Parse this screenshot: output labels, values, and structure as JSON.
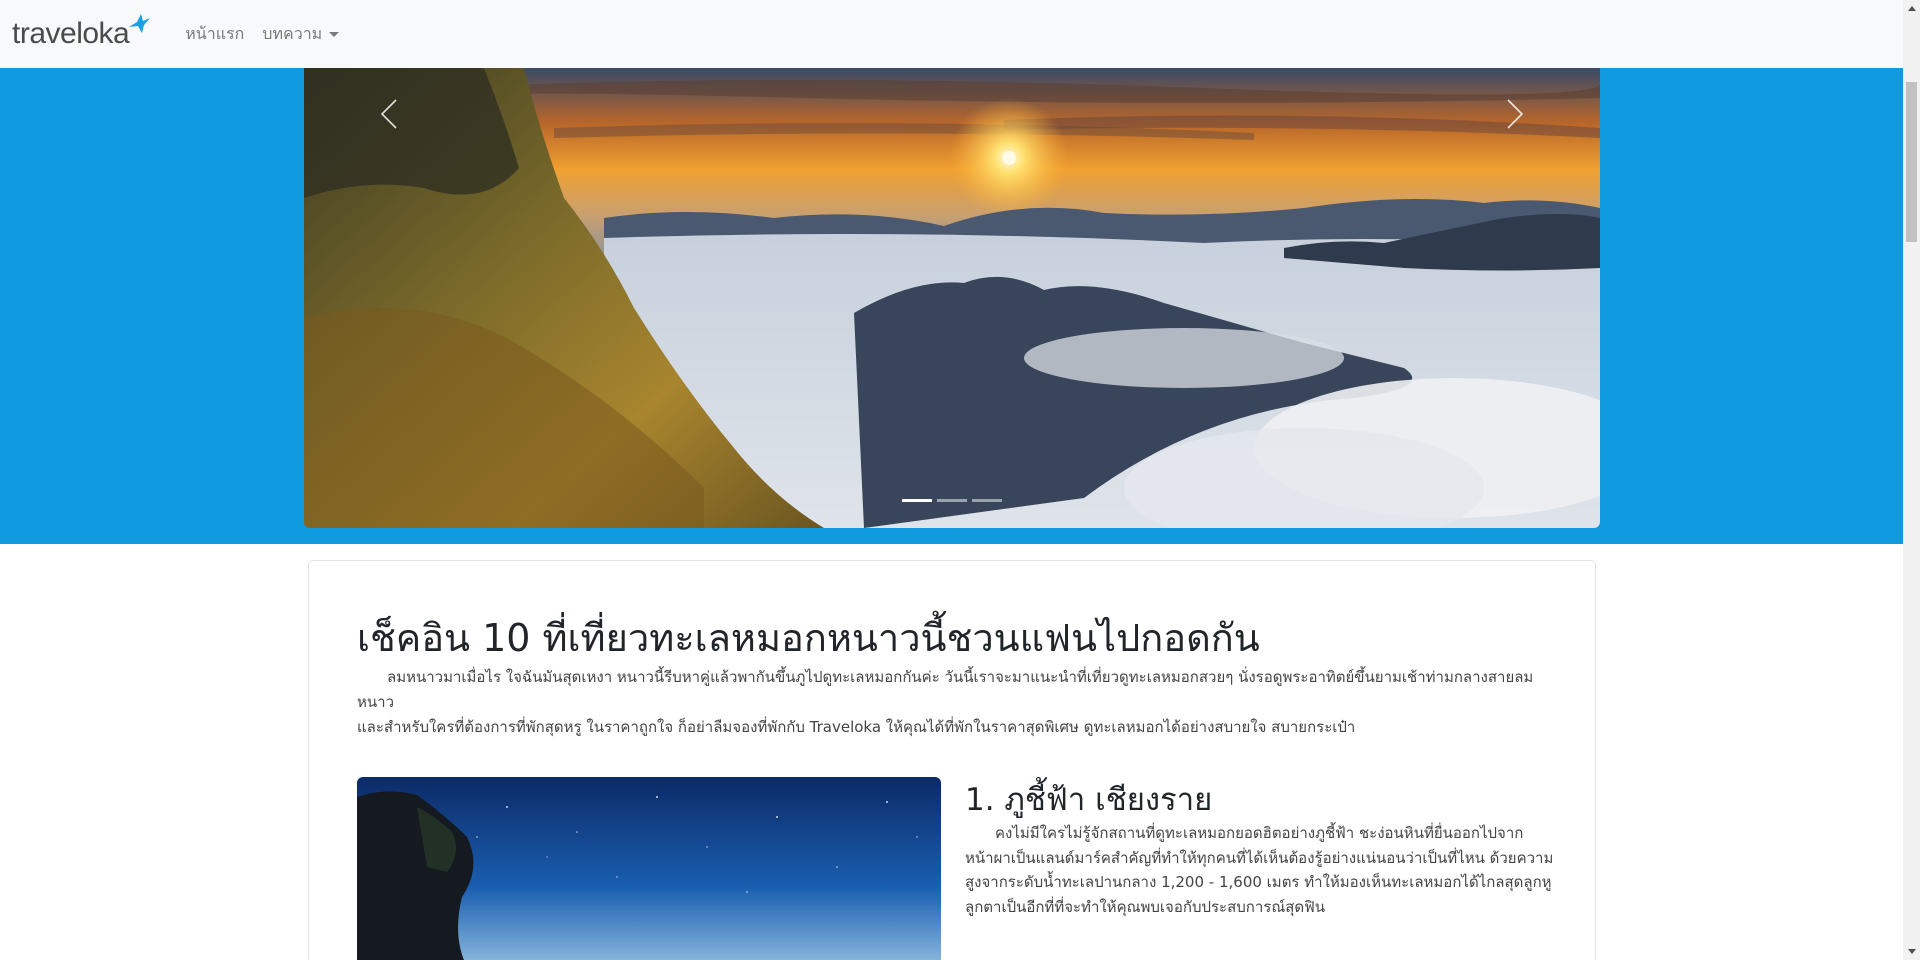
{
  "navbar": {
    "brand": "traveloka",
    "home_label": "หน้าแรก",
    "articles_label": "บทความ"
  },
  "carousel": {
    "prev_icon": "chevron-left-icon",
    "next_icon": "chevron-right-icon",
    "indicator_count": 3,
    "active_index": 0
  },
  "article": {
    "title": "เช็คอิน 10 ที่เที่ยวทะเลหมอกหนาวนี้ชวนแฟนไปกอดกัน",
    "intro_line1": "ลมหนาวมาเมื่อไร ใจฉันมันสุดเหงา หนาวนี้รีบหาคู่แล้วพากันขึ้นภูไปดูทะเลหมอกกันค่ะ วันนี้เราจะมาแนะนำที่เที่ยวดูทะเลหมอกสวยๆ นั่งรอดูพระอาทิตย์ขึ้นยามเช้าท่ามกลางสายลมหนาว",
    "intro_line2": "และสำหรับใครที่ต้องการที่พักสุดหรู ในราคาถูกใจ ก็อย่าลืมจองที่พักกับ Traveloka ให้คุณได้ที่พักในราคาสุดพิเศษ ดูทะเลหมอกได้อย่างสบายใจ สบายกระเป๋า",
    "section1_title": "1. ภูชี้ฟ้า เชียงราย",
    "section1_text": "คงไม่มีใครไม่รู้จักสถานที่ดูทะเลหมอกยอดฮิตอย่างภูชี้ฟ้า ชะง่อนหินที่ยื่นออกไปจากหน้าผาเป็นแลนด์มาร์คสำคัญที่ทำให้ทุกคนที่ได้เห็นต้องรู้อย่างแน่นอนว่าเป็นที่ไหน ด้วยความสูงจากระดับน้ำทะเลปานกลาง 1,200 - 1,600 เมตร ทำให้มองเห็นทะเลหมอกได้ไกลสุดลูกหูลูกตาเป็นอีกที่ที่จะทำให้คุณพบเจอกับประสบการณ์สุดฟิน"
  },
  "colors": {
    "hero_bg": "#0f9ae0",
    "brand_bird": "#1ba0e2",
    "navbar_bg": "#f8f9fa"
  }
}
